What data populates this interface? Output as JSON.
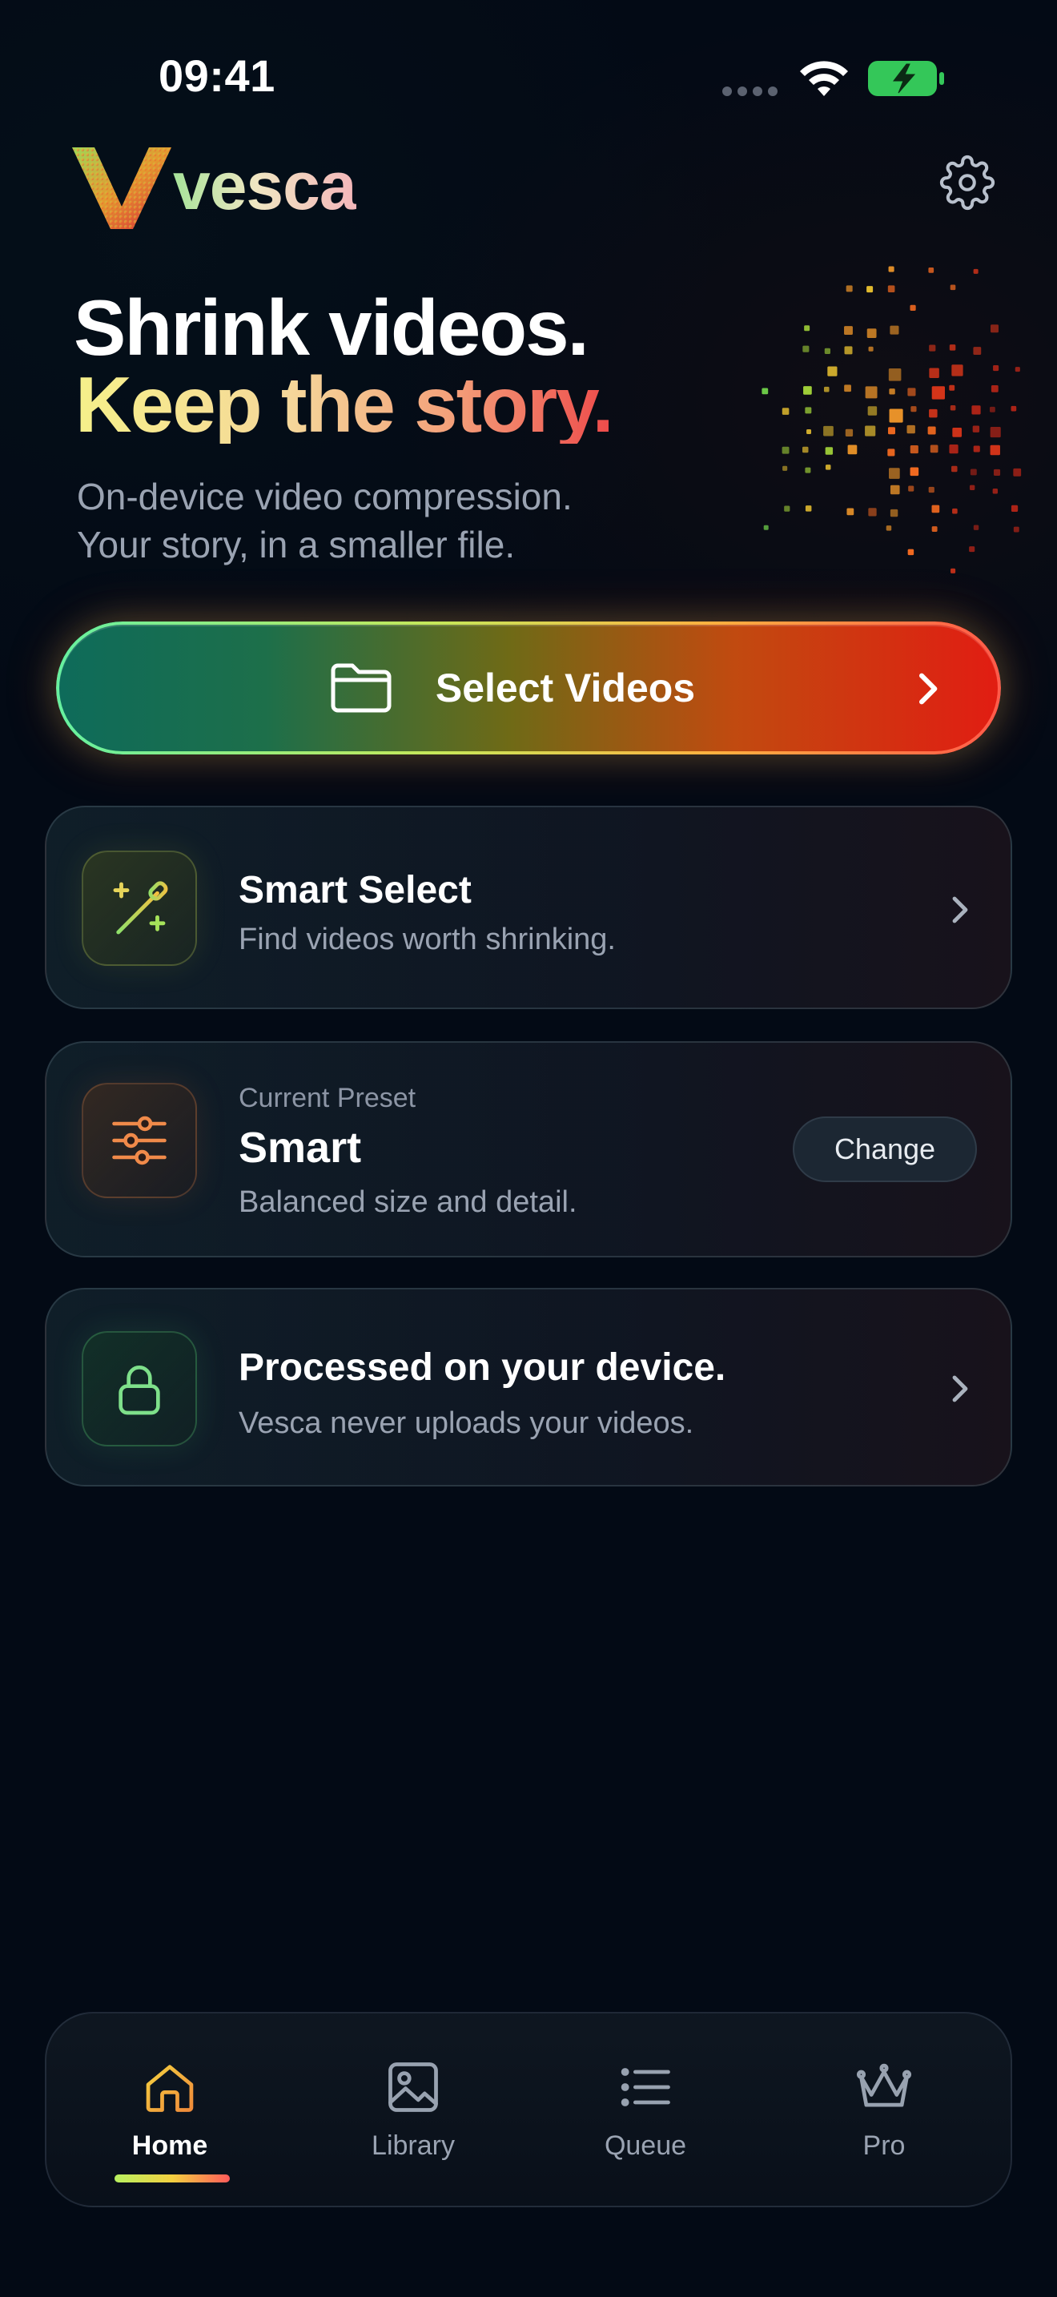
{
  "status_bar": {
    "time": "09:41"
  },
  "header": {
    "app_name": "vesca",
    "settings_icon": "gear-icon"
  },
  "hero": {
    "title_line1": "Shrink videos.",
    "title_line2": "Keep the story.",
    "subtitle_line1": "On-device video compression.",
    "subtitle_line2": "Your story, in a smaller file."
  },
  "select_videos": {
    "label": "Select Videos",
    "icon": "folder-icon"
  },
  "cards": {
    "smart_select": {
      "title": "Smart Select",
      "subtitle": "Find videos worth shrinking.",
      "icon": "magic-wand-icon"
    },
    "preset": {
      "kicker": "Current Preset",
      "title": "Smart",
      "subtitle": "Balanced size and detail.",
      "button_label": "Change",
      "icon": "sliders-icon"
    },
    "device": {
      "title": "Processed on your device.",
      "subtitle": "Vesca never uploads your videos.",
      "icon": "lock-icon"
    }
  },
  "tab_bar": {
    "tabs": [
      {
        "label": "Home",
        "icon": "home-icon",
        "active": true
      },
      {
        "label": "Library",
        "icon": "image-icon",
        "active": false
      },
      {
        "label": "Queue",
        "icon": "list-icon",
        "active": false
      },
      {
        "label": "Pro",
        "icon": "crown-icon",
        "active": false
      }
    ]
  },
  "colors": {
    "background": "#030a15",
    "accent_green": "#66f0a0",
    "accent_orange": "#ffb040",
    "accent_red": "#ff5a4a",
    "muted_text": "#9aa3b2"
  }
}
